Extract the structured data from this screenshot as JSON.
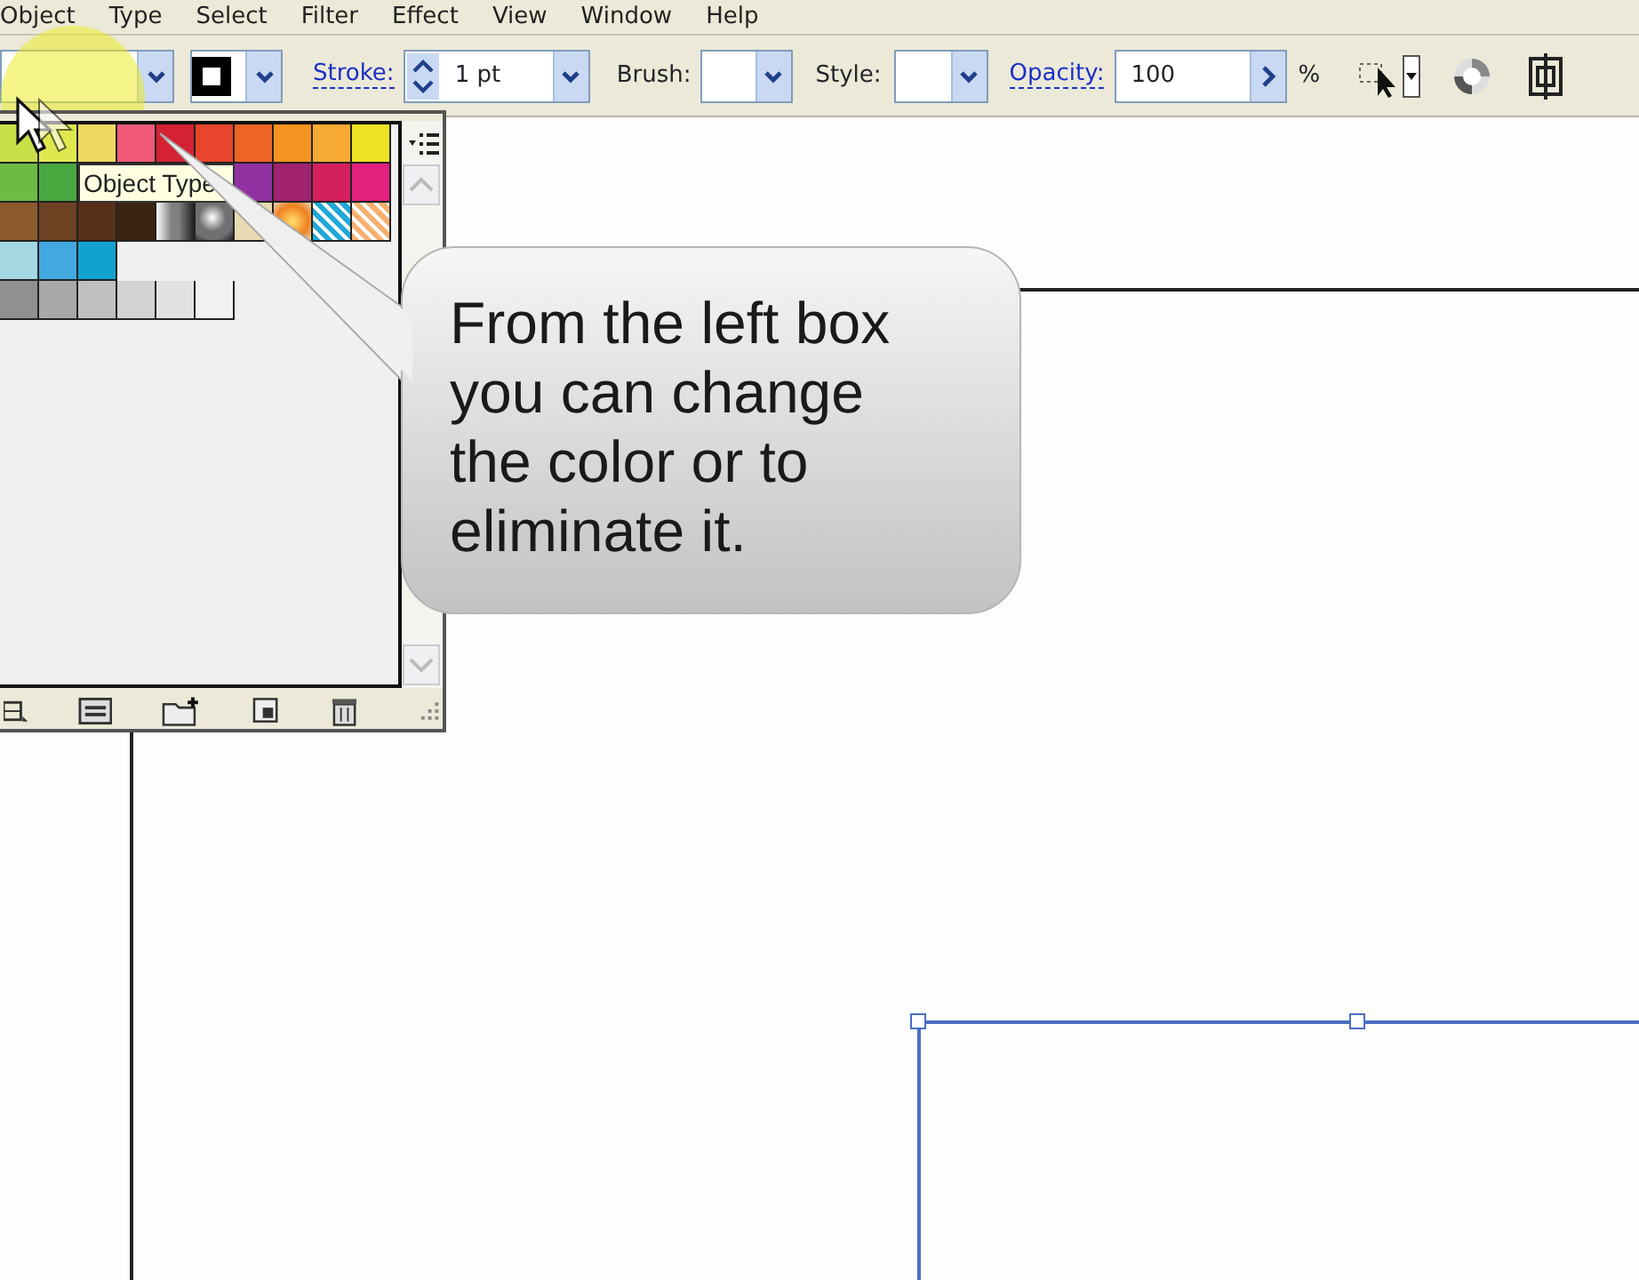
{
  "menu_bar": {
    "items": [
      "Object",
      "Type",
      "Select",
      "Filter",
      "Effect",
      "View",
      "Window",
      "Help"
    ]
  },
  "control_bar": {
    "stroke_label": "Stroke:",
    "stroke_weight": "1 pt",
    "brush_label": "Brush:",
    "style_label": "Style:",
    "opacity_label": "Opacity:",
    "opacity_value": "100",
    "opacity_unit": "%"
  },
  "swatches_panel": {
    "rows": [
      [
        {
          "kind": "solid",
          "color": "#c8e048"
        },
        {
          "kind": "solid",
          "color": "#e0e850"
        },
        {
          "kind": "solid",
          "color": "#f0d860"
        },
        {
          "kind": "solid",
          "color": "#f05a78"
        },
        {
          "kind": "solid",
          "color": "#d42234"
        },
        {
          "kind": "solid",
          "color": "#e8442e"
        },
        {
          "kind": "solid",
          "color": "#ee6424"
        },
        {
          "kind": "solid",
          "color": "#f59220"
        },
        {
          "kind": "solid",
          "color": "#f7aa34"
        },
        {
          "kind": "solid",
          "color": "#eee224"
        }
      ],
      [
        {
          "kind": "solid",
          "color": "#6cbc44"
        },
        {
          "kind": "solid",
          "color": "#4aa840"
        },
        {
          "kind": "tooltip",
          "text": "Object Type"
        },
        {
          "kind": "solid",
          "color": "#9232a2"
        },
        {
          "kind": "solid",
          "color": "#a0226e"
        },
        {
          "kind": "solid",
          "color": "#d4205e"
        },
        {
          "kind": "solid",
          "color": "#e2207e"
        }
      ],
      [
        {
          "kind": "solid",
          "color": "#8a5a2c"
        },
        {
          "kind": "solid",
          "color": "#6c4222"
        },
        {
          "kind": "solid",
          "color": "#583018"
        },
        {
          "kind": "solid",
          "color": "#3c2412"
        },
        {
          "kind": "gradient",
          "color": "#808080"
        },
        {
          "kind": "sphere",
          "color": "#707070"
        },
        {
          "kind": "solid",
          "color": "#e8dab2"
        },
        {
          "kind": "glow"
        },
        {
          "kind": "pattern",
          "color": "#20a8d8"
        },
        {
          "kind": "pattern",
          "color": "#f8b070"
        }
      ],
      [
        {
          "kind": "solid",
          "color": "#a4d8e2"
        },
        {
          "kind": "solid",
          "color": "#42a8e0"
        },
        {
          "kind": "solid",
          "color": "#12a2d2"
        }
      ],
      [
        {
          "kind": "solid",
          "color": "#909090"
        },
        {
          "kind": "solid",
          "color": "#a8a8a8"
        },
        {
          "kind": "solid",
          "color": "#c0c0c0"
        },
        {
          "kind": "solid",
          "color": "#d2d2d2"
        },
        {
          "kind": "solid",
          "color": "#e2e2e2"
        },
        {
          "kind": "solid",
          "color": "#f2f2f2"
        }
      ]
    ]
  },
  "callout": {
    "text": "From the left box you can change the color or to eliminate it."
  }
}
